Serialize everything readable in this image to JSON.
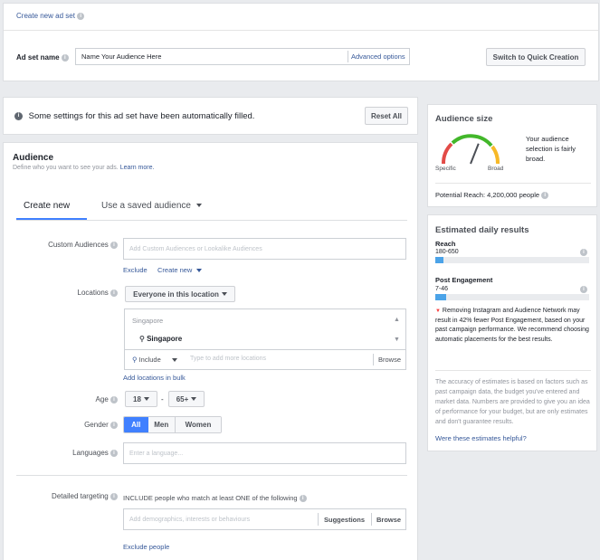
{
  "top": {
    "create_link": "Create new ad set",
    "adset_label": "Ad set name",
    "adset_value": "Name Your Audience Here",
    "advanced_options": "Advanced options",
    "quick_creation": "Switch to Quick Creation"
  },
  "notice": {
    "text": "Some settings for this ad set have been automatically filled.",
    "reset": "Reset All"
  },
  "audience": {
    "title": "Audience",
    "subtitle_prefix": "Define who you want to see your ads.",
    "learn_more": "Learn more.",
    "tab_create": "Create new",
    "tab_saved": "Use a saved audience",
    "custom_label": "Custom Audiences",
    "custom_placeholder": "Add Custom Audiences or Lookalike Audiences",
    "exclude": "Exclude",
    "create_new": "Create new",
    "locations_label": "Locations",
    "locations_select": "Everyone in this location",
    "location_country_group": "Singapore",
    "location_selected": "Singapore",
    "include": "Include",
    "location_placeholder": "Type to add more locations",
    "browse": "Browse",
    "add_bulk": "Add locations in bulk",
    "age_label": "Age",
    "age_min": "18",
    "age_sep": "-",
    "age_max": "65+",
    "gender_label": "Gender",
    "gender_all": "All",
    "gender_men": "Men",
    "gender_women": "Women",
    "languages_label": "Languages",
    "languages_placeholder": "Enter a language...",
    "detailed_label": "Detailed targeting",
    "detailed_text": "INCLUDE people who match at least ONE of the following",
    "detailed_placeholder": "Add demographics, interests or behaviours",
    "suggestions": "Suggestions",
    "browse2": "Browse",
    "exclude_people": "Exclude people"
  },
  "size": {
    "title": "Audience size",
    "desc": "Your audience selection is fairly broad.",
    "specific": "Specific",
    "broad": "Broad",
    "potential": "Potential Reach: 4,200,000 people",
    "gauge_level": 0.62
  },
  "daily": {
    "title": "Estimated daily results",
    "reach_label": "Reach",
    "reach_range": "180-650",
    "reach_level": 0.05,
    "post_label": "Post Engagement",
    "post_range": "7-46",
    "post_level": 0.07,
    "warning": "Removing Instagram and Audience Network may result in 42% fewer Post Engagement, based on your past campaign performance. We recommend choosing automatic placements for the best results.",
    "accuracy": "The accuracy of estimates is based on factors such as past campaign data, the budget you've entered and market data. Numbers are provided to give you an idea of performance for your budget, but are only estimates and don't guarantee results.",
    "helpful": "Were these estimates helpful?"
  },
  "colors": {
    "link": "#365899",
    "accent": "#4080ff",
    "bar": "#4ba3e8"
  }
}
